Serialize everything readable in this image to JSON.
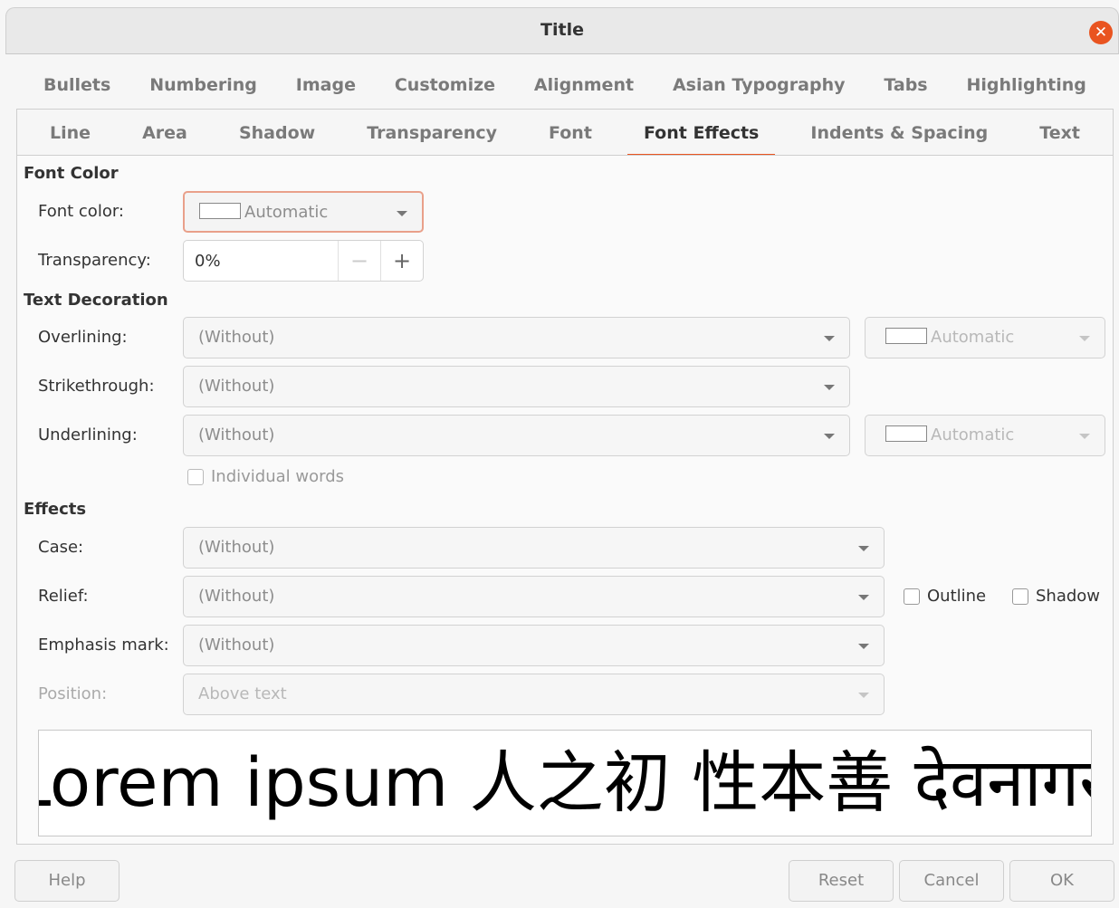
{
  "window": {
    "title": "Title"
  },
  "tabs_row1": [
    "Bullets",
    "Numbering",
    "Image",
    "Customize",
    "Alignment",
    "Asian Typography",
    "Tabs",
    "Highlighting"
  ],
  "tabs_row2": [
    "Line",
    "Area",
    "Shadow",
    "Transparency",
    "Font",
    "Font Effects",
    "Indents & Spacing",
    "Text"
  ],
  "active_tab": "Font Effects",
  "font_color": {
    "heading": "Font Color",
    "color_label": "Font color:",
    "color_value": "Automatic",
    "transparency_label": "Transparency:",
    "transparency_value": "0%",
    "minus_icon": "−",
    "plus_icon": "+"
  },
  "text_decoration": {
    "heading": "Text Decoration",
    "overlining_label": "Overlining:",
    "overlining_value": "(Without)",
    "overlining_color": "Automatic",
    "strikethrough_label": "Strikethrough:",
    "strikethrough_value": "(Without)",
    "underlining_label": "Underlining:",
    "underlining_value": "(Without)",
    "underlining_color": "Automatic",
    "individual_words": "Individual words"
  },
  "effects": {
    "heading": "Effects",
    "case_label": "Case:",
    "case_value": "(Without)",
    "relief_label": "Relief:",
    "relief_value": "(Without)",
    "outline_label": "Outline",
    "shadow_label": "Shadow",
    "emphasis_label": "Emphasis mark:",
    "emphasis_value": "(Without)",
    "position_label": "Position:",
    "position_value": "Above text"
  },
  "preview": {
    "text": "Lorem ipsum   人之初 性本善   देवनागरी"
  },
  "buttons": {
    "help": "Help",
    "reset": "Reset",
    "cancel": "Cancel",
    "ok": "OK"
  },
  "colors": {
    "accent": "#e95420",
    "focus_border": "#e9a08a"
  }
}
